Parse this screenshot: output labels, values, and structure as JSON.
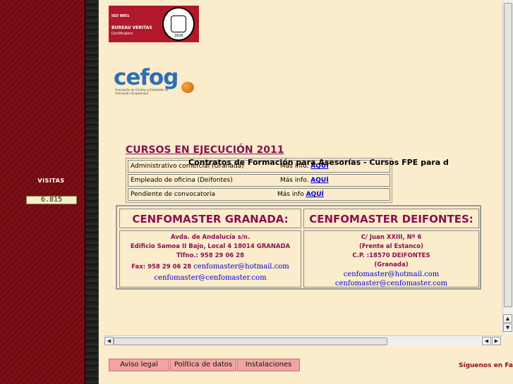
{
  "visits": {
    "label": "VISITAS",
    "count": "6.815"
  },
  "cert_logo": {
    "line1": "ISO 9001",
    "line2": "BUREAU VERITAS",
    "line3": "Certification",
    "year": "1828"
  },
  "cefog_logo": {
    "word": "cefog",
    "tagline": "Asociación de Centros y Entidades de Formación Ocupacional"
  },
  "courses": {
    "title": "CURSOS EN EJECUCIÓN 2011",
    "marquee": "Contratos de Formación para Asesorías      -      Cursos FPE para d",
    "rows": [
      {
        "name": "Administrativo comercial (Granada)",
        "more": "Más info.",
        "link": "AQUÍ"
      },
      {
        "name": "Empleado de oficina (Deifontes)",
        "more": "Más info.",
        "link": "AQUÍ"
      },
      {
        "name": "Pendiente de convocatoria",
        "more": "Más info",
        "link": "AQUÍ"
      }
    ]
  },
  "locations": {
    "granada": {
      "title": "CENFOMASTER GRANADA:",
      "address1": "Avda. de Andalucía s/n.",
      "address2": "Edificio Samoa II Bajo, Local 4  18014 GRANADA",
      "phone": "Tlfno.: 958 29 06 28",
      "fax": "Fax: 958 29 06 28",
      "email1": "cenfomaster@hotmail.com",
      "email2": "cenfomaster@cenfomaster.com"
    },
    "deifontes": {
      "title": "CENFOMASTER DEIFONTES:",
      "address1": "C/ Juan XXIII, Nº 6",
      "address2": "(Frente al Estanco)",
      "postal": "C.P. :18570 DEIFONTES",
      "province": "(Granada)",
      "email1": "cenfomaster@hotmail.com",
      "email2": "cenfomaster@cenfomaster.com"
    }
  },
  "scrollbar": {
    "up": "▲",
    "down": "▼",
    "left": "◀",
    "right": "▶"
  },
  "footer": {
    "tabs": [
      "Aviso legal",
      "Política de datos",
      "Instalaciones"
    ],
    "social": "Síguenos en Fa"
  },
  "colors": {
    "panel_red": "#7a0c12",
    "accent_magenta": "#8a1050",
    "page_bg": "#fbeccb",
    "link_blue": "#0000cc"
  }
}
